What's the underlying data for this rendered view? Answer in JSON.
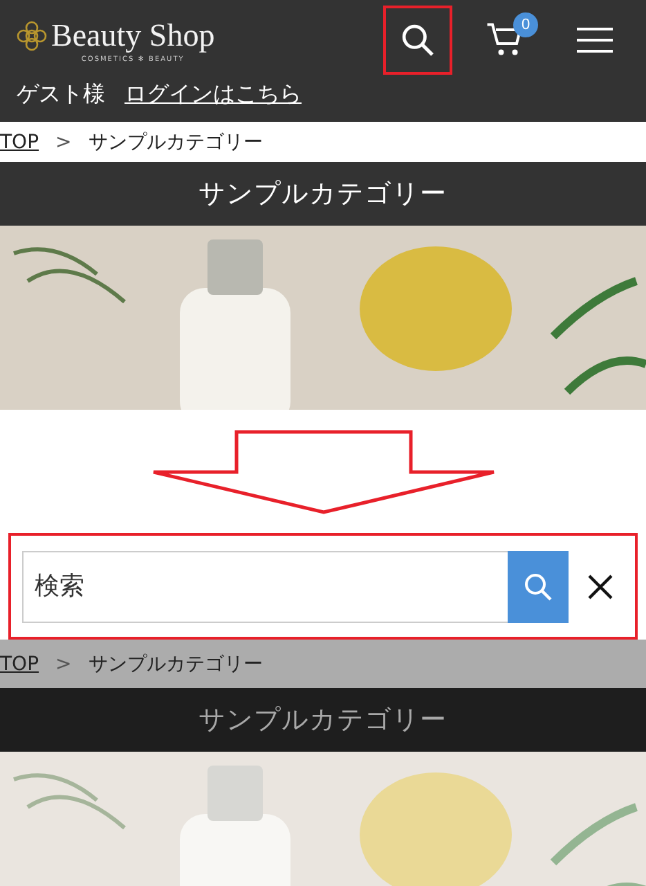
{
  "header": {
    "logo": {
      "name": "Beauty Shop",
      "tagline": "COSMETICS ✻ BEAUTY"
    },
    "search_highlighted": true,
    "cart_count": "0",
    "guest_label": "ゲスト様",
    "login_link": "ログインはこちら"
  },
  "views": [
    {
      "breadcrumb": {
        "home": "TOP",
        "separator": ">",
        "current": "サンプルカテゴリー"
      },
      "title": "サンプルカテゴリー",
      "dimmed": false
    },
    {
      "breadcrumb": {
        "home": "TOP",
        "separator": ">",
        "current": "サンプルカテゴリー"
      },
      "title": "サンプルカテゴリー",
      "dimmed": true
    }
  ],
  "search_panel": {
    "placeholder": "検索"
  }
}
